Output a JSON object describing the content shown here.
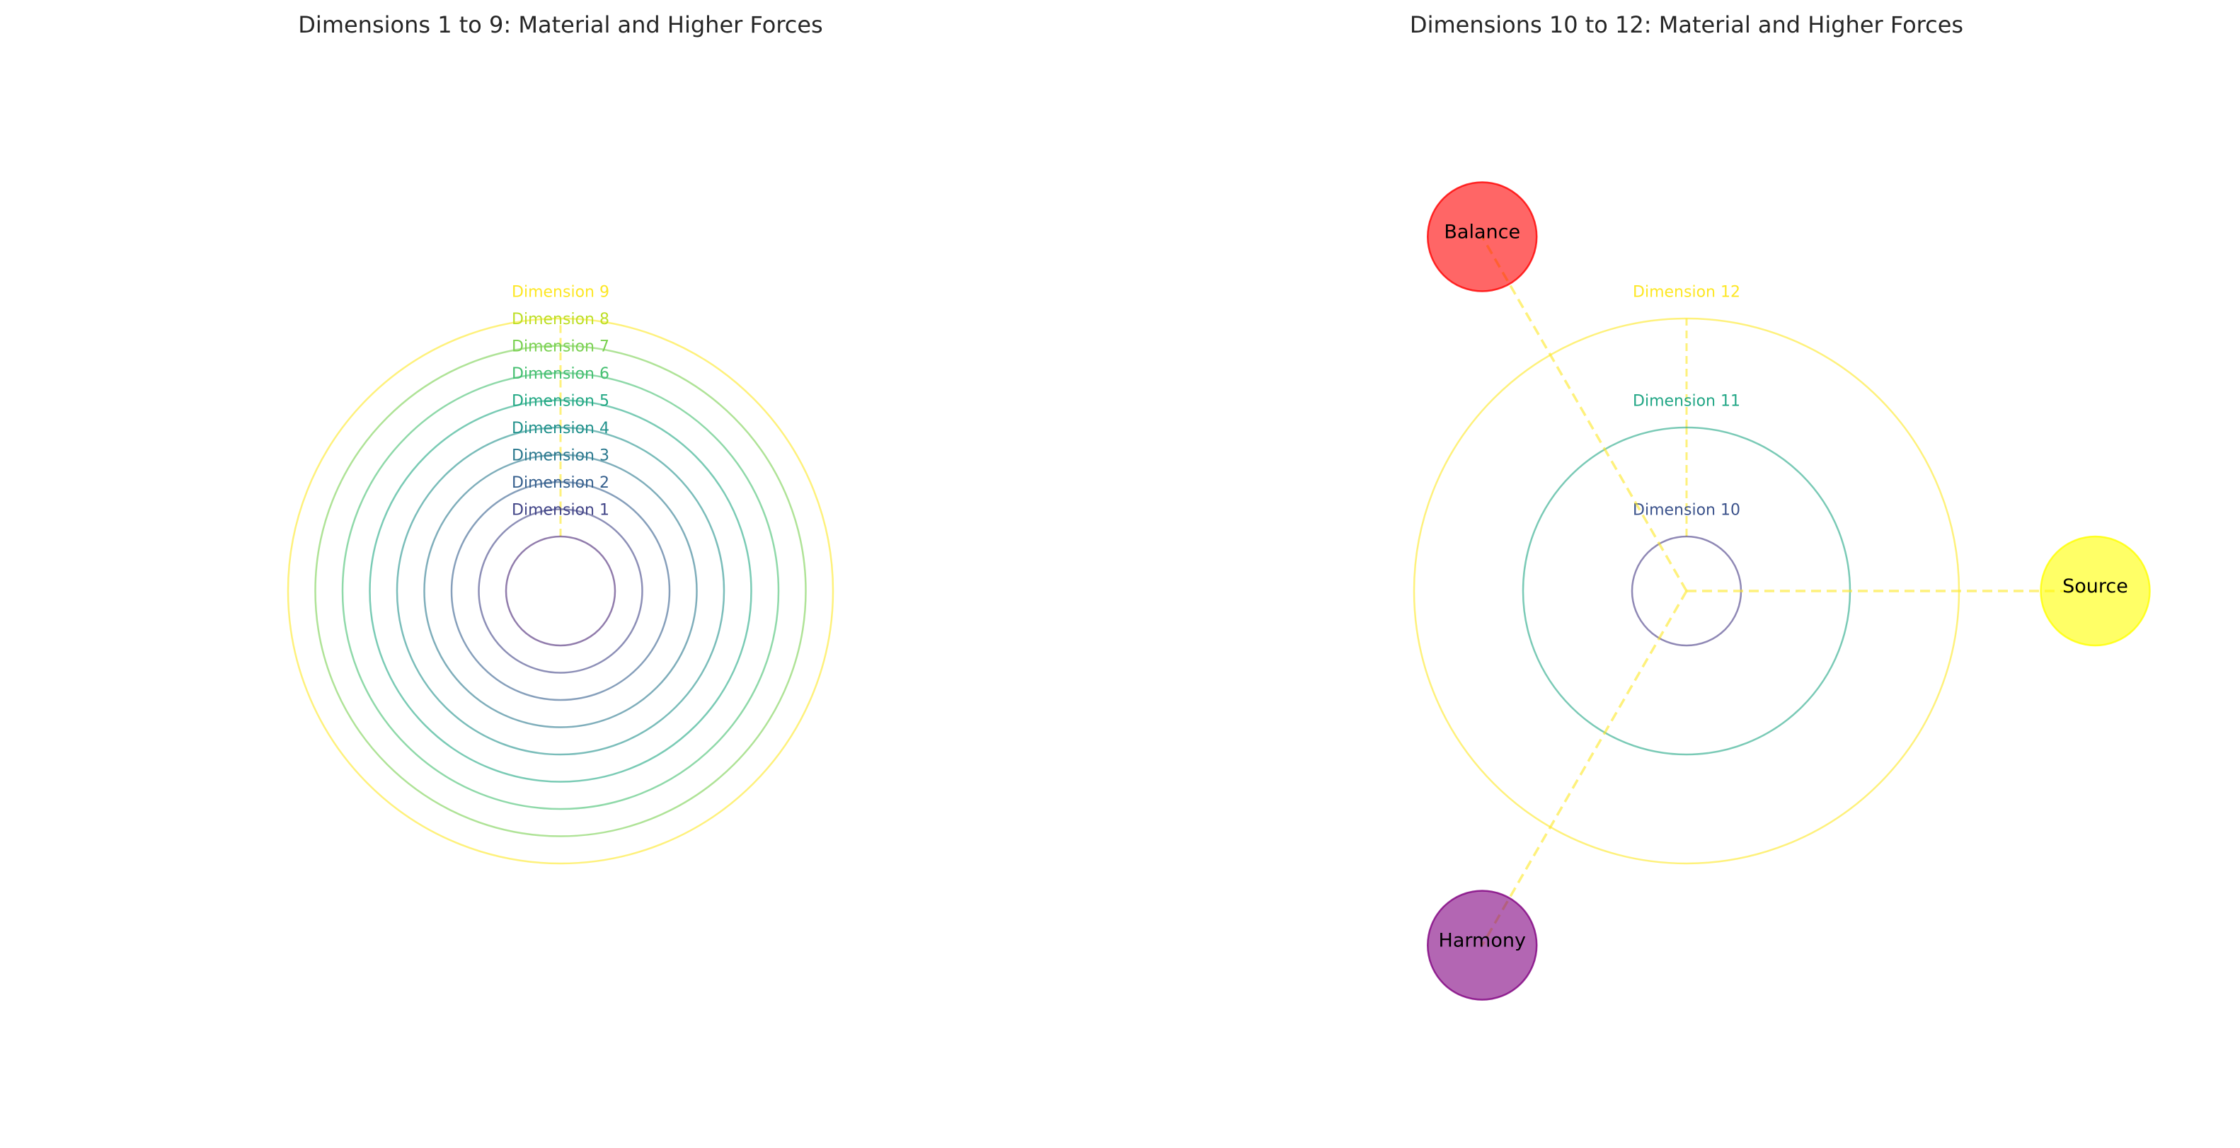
{
  "chart_data": [
    {
      "type": "diagram",
      "title": "Dimensions 1 to 9: Material and Higher Forces",
      "rings": [
        {
          "label": "Dimension 1",
          "radius": 1,
          "color": "#482475"
        },
        {
          "label": "Dimension 2",
          "radius": 1.5,
          "color": "#414487"
        },
        {
          "label": "Dimension 3",
          "radius": 2,
          "color": "#355f8d"
        },
        {
          "label": "Dimension 4",
          "radius": 2.5,
          "color": "#2a788e"
        },
        {
          "label": "Dimension 5",
          "radius": 3,
          "color": "#21918c"
        },
        {
          "label": "Dimension 6",
          "radius": 3.5,
          "color": "#22a884"
        },
        {
          "label": "Dimension 7",
          "radius": 4,
          "color": "#44bf70"
        },
        {
          "label": "Dimension 8",
          "radius": 4.5,
          "color": "#7ad151"
        },
        {
          "label": "Dimension 9",
          "radius": 5,
          "color": "#fde725"
        }
      ],
      "label_colors": [
        "#414487",
        "#355f8d",
        "#2a788e",
        "#21918c",
        "#22a884",
        "#44bf70",
        "#7ad151",
        "#bddf26",
        "#fde725"
      ],
      "connector_color": "#fde725",
      "xlim": [
        -10,
        10
      ],
      "ylim": [
        -10,
        10
      ]
    },
    {
      "type": "diagram",
      "title": "Dimensions 10 to 12: Material and Higher Forces",
      "rings": [
        {
          "label": "Dimension 10",
          "radius": 1,
          "color": "#443983"
        },
        {
          "label": "Dimension 11",
          "radius": 3,
          "color": "#21a685"
        },
        {
          "label": "Dimension 12",
          "radius": 5,
          "color": "#fde725"
        }
      ],
      "label_colors": [
        "#3b528b",
        "#21a685",
        "#fde725"
      ],
      "connector_color": "#fde725",
      "forces": [
        {
          "label": "Source",
          "x": 7.5,
          "y": 0,
          "color": "#ffff00"
        },
        {
          "label": "Balance",
          "x": -3.75,
          "y": 6.5,
          "color": "#ff0000"
        },
        {
          "label": "Harmony",
          "x": -3.75,
          "y": -6.5,
          "color": "#800080"
        }
      ],
      "xlim": [
        -10,
        10
      ],
      "ylim": [
        -10,
        10
      ]
    }
  ]
}
